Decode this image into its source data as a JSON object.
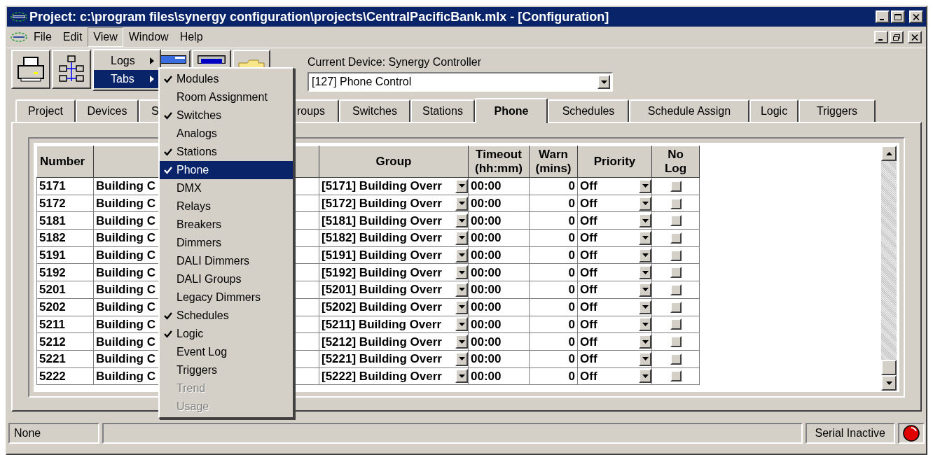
{
  "window": {
    "title": "Project: c:\\program files\\synergy configuration\\projects\\CentralPacificBank.mlx - [Configuration]"
  },
  "menu": [
    {
      "label": "File",
      "selected": false
    },
    {
      "label": "Edit",
      "selected": false
    },
    {
      "label": "View",
      "selected": true
    },
    {
      "label": "Window",
      "selected": false
    },
    {
      "label": "Help",
      "selected": false
    }
  ],
  "view_menu": [
    {
      "label": "Logs",
      "selected": false
    },
    {
      "label": "Tabs",
      "selected": true
    }
  ],
  "tabs_menu": [
    {
      "label": "Modules",
      "checked": true,
      "selected": false,
      "disabled": false
    },
    {
      "label": "Room Assignment",
      "checked": false,
      "selected": false,
      "disabled": false
    },
    {
      "label": "Switches",
      "checked": true,
      "selected": false,
      "disabled": false
    },
    {
      "label": "Analogs",
      "checked": false,
      "selected": false,
      "disabled": false
    },
    {
      "label": "Stations",
      "checked": true,
      "selected": false,
      "disabled": false
    },
    {
      "label": "Phone",
      "checked": true,
      "selected": true,
      "disabled": false
    },
    {
      "label": "DMX",
      "checked": false,
      "selected": false,
      "disabled": false
    },
    {
      "label": "Relays",
      "checked": false,
      "selected": false,
      "disabled": false
    },
    {
      "label": "Breakers",
      "checked": false,
      "selected": false,
      "disabled": false
    },
    {
      "label": "Dimmers",
      "checked": false,
      "selected": false,
      "disabled": false
    },
    {
      "label": "DALI Dimmers",
      "checked": false,
      "selected": false,
      "disabled": false
    },
    {
      "label": "DALI Groups",
      "checked": false,
      "selected": false,
      "disabled": false
    },
    {
      "label": "Legacy Dimmers",
      "checked": false,
      "selected": false,
      "disabled": false
    },
    {
      "label": "Schedules",
      "checked": true,
      "selected": false,
      "disabled": false
    },
    {
      "label": "Logic",
      "checked": true,
      "selected": false,
      "disabled": false
    },
    {
      "label": "Event Log",
      "checked": false,
      "selected": false,
      "disabled": false
    },
    {
      "label": "Triggers",
      "checked": false,
      "selected": false,
      "disabled": false
    },
    {
      "label": "Trend",
      "checked": false,
      "selected": false,
      "disabled": true
    },
    {
      "label": "Usage",
      "checked": false,
      "selected": false,
      "disabled": true
    }
  ],
  "device": {
    "label": "Current Device: Synergy Controller",
    "value": "[127] Phone Control"
  },
  "tabs": [
    {
      "label": "Project",
      "selected": false
    },
    {
      "label": "Devices",
      "selected": false
    },
    {
      "label": "S",
      "selected": false
    },
    {
      "label": "roups",
      "selected": false
    },
    {
      "label": "Switches",
      "selected": false
    },
    {
      "label": "Stations",
      "selected": false
    },
    {
      "label": "Phone",
      "selected": true
    },
    {
      "label": "Schedules",
      "selected": false
    },
    {
      "label": "Schedule Assign",
      "selected": false
    },
    {
      "label": "Logic",
      "selected": false
    },
    {
      "label": "Triggers",
      "selected": false
    }
  ],
  "table": {
    "columns": [
      "Number",
      "Group",
      "Timeout\n(hh:mm)",
      "Warn\n(mins)",
      "Priority",
      "No\nLog"
    ],
    "rows": [
      {
        "number": "5171",
        "name": "Building C",
        "group": "[5171] Building Overr",
        "timeout": "00:00",
        "warn": "0",
        "priority": "Off",
        "no_log": false
      },
      {
        "number": "5172",
        "name": "Building C",
        "group": "[5172] Building Overr",
        "timeout": "00:00",
        "warn": "0",
        "priority": "Off",
        "no_log": false
      },
      {
        "number": "5181",
        "name": "Building C",
        "group": "[5181] Building Overr",
        "timeout": "00:00",
        "warn": "0",
        "priority": "Off",
        "no_log": false
      },
      {
        "number": "5182",
        "name": "Building C",
        "group": "[5182] Building Overr",
        "timeout": "00:00",
        "warn": "0",
        "priority": "Off",
        "no_log": false
      },
      {
        "number": "5191",
        "name": "Building C",
        "group": "[5191] Building Overr",
        "timeout": "00:00",
        "warn": "0",
        "priority": "Off",
        "no_log": false
      },
      {
        "number": "5192",
        "name": "Building C",
        "group": "[5192] Building Overr",
        "timeout": "00:00",
        "warn": "0",
        "priority": "Off",
        "no_log": false
      },
      {
        "number": "5201",
        "name": "Building C",
        "group": "[5201] Building Overr",
        "timeout": "00:00",
        "warn": "0",
        "priority": "Off",
        "no_log": false
      },
      {
        "number": "5202",
        "name": "Building C",
        "group": "[5202] Building Overr",
        "timeout": "00:00",
        "warn": "0",
        "priority": "Off",
        "no_log": false
      },
      {
        "number": "5211",
        "name": "Building C",
        "group": "[5211] Building Overr",
        "timeout": "00:00",
        "warn": "0",
        "priority": "Off",
        "no_log": false
      },
      {
        "number": "5212",
        "name": "Building C",
        "group": "[5212] Building Overr",
        "timeout": "00:00",
        "warn": "0",
        "priority": "Off",
        "no_log": false
      },
      {
        "number": "5221",
        "name": "Building C",
        "group": "[5221] Building Overr",
        "timeout": "00:00",
        "warn": "0",
        "priority": "Off",
        "no_log": false
      },
      {
        "number": "5222",
        "name": "Building C",
        "group": "[5222] Building Overr",
        "timeout": "00:00",
        "warn": "0",
        "priority": "Off",
        "no_log": false
      }
    ]
  },
  "status_bar": {
    "left": "None",
    "right": "Serial Inactive"
  }
}
